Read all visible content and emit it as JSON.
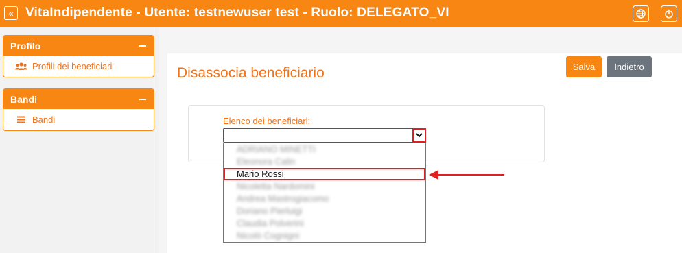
{
  "header": {
    "title": "VitaIndipendente - Utente: testnewuser test - Ruolo: DELEGATO_VI",
    "back_icon": "«",
    "colors": {
      "brand": "#f88613"
    }
  },
  "sidebar": {
    "sections": [
      {
        "title": "Profilo",
        "items": [
          {
            "label": "Profili dei beneficiari",
            "icon": "users-icon"
          }
        ]
      },
      {
        "title": "Bandi",
        "items": [
          {
            "label": "Bandi",
            "icon": "list-icon"
          }
        ]
      }
    ]
  },
  "main": {
    "page_title": "Disassocia beneficiario",
    "buttons": {
      "save": "Salva",
      "back": "Indietro"
    },
    "form": {
      "label": "Elenco dei beneficiari:",
      "selected_value": "",
      "options": [
        "ADRIANO MINETTI",
        "Eleonora Calin",
        "Mario Rossi",
        "Nicoletta Nardomini",
        "Andrea Mastrogiacomo",
        "Doriano Pierluigi",
        "Claudia Polverini",
        "Nicolò Cognigni"
      ],
      "highlighted_option": "Mario Rossi"
    }
  },
  "annotation": {
    "color": "#e02020"
  }
}
